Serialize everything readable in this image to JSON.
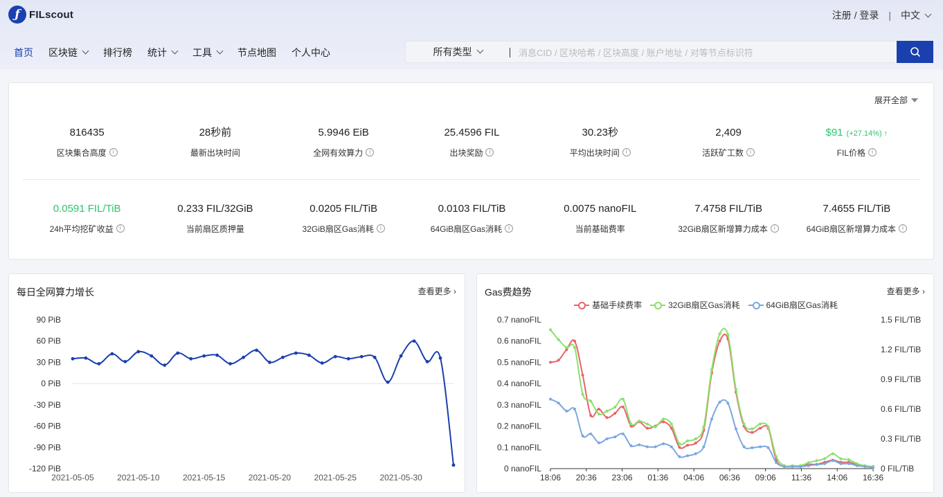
{
  "header": {
    "logo_text": "FILscout",
    "auth": "注册 / 登录",
    "separator": "|",
    "language": "中文"
  },
  "nav": {
    "items": [
      {
        "label": "首页",
        "active": true,
        "dropdown": false
      },
      {
        "label": "区块链",
        "active": false,
        "dropdown": true
      },
      {
        "label": "排行榜",
        "active": false,
        "dropdown": false
      },
      {
        "label": "统计",
        "active": false,
        "dropdown": true
      },
      {
        "label": "工具",
        "active": false,
        "dropdown": true
      },
      {
        "label": "节点地图",
        "active": false,
        "dropdown": false
      },
      {
        "label": "个人中心",
        "active": false,
        "dropdown": false
      }
    ]
  },
  "search": {
    "type_label": "所有类型",
    "placeholder": "消息CID / 区块哈希 / 区块高度 / 账户地址 / 对等节点标识符"
  },
  "stats": {
    "expand_label": "展开全部",
    "row1": [
      {
        "value": "816435",
        "label": "区块集合高度",
        "info": true
      },
      {
        "value": "28秒前",
        "label": "最新出块时间",
        "info": false
      },
      {
        "value": "5.9946 EiB",
        "label": "全网有效算力",
        "info": true
      },
      {
        "value": "25.4596 FIL",
        "label": "出块奖励",
        "info": true
      },
      {
        "value": "30.23秒",
        "label": "平均出块时间",
        "info": true
      },
      {
        "value": "2,409",
        "label": "活跃矿工数",
        "info": true
      },
      {
        "value": "$91",
        "change": "(+27.14%) ↑",
        "label": "FIL价格",
        "info": true,
        "green": true
      }
    ],
    "row2": [
      {
        "value": "0.0591 FIL/TiB",
        "label": "24h平均挖矿收益",
        "info": true,
        "green": true
      },
      {
        "value": "0.233 FIL/32GiB",
        "label": "当前扇区质押量",
        "info": false
      },
      {
        "value": "0.0205 FIL/TiB",
        "label": "32GiB扇区Gas消耗",
        "info": true
      },
      {
        "value": "0.0103 FIL/TiB",
        "label": "64GiB扇区Gas消耗",
        "info": true
      },
      {
        "value": "0.0075 nanoFIL",
        "label": "当前基础费率",
        "info": false
      },
      {
        "value": "7.4758 FIL/TiB",
        "label": "32GiB扇区新增算力成本",
        "info": true
      },
      {
        "value": "7.4655 FIL/TiB",
        "label": "64GiB扇区新增算力成本",
        "info": true
      }
    ]
  },
  "power_chart": {
    "title": "每日全网算力增长",
    "more_label": "查看更多 ›"
  },
  "gas_chart": {
    "title": "Gas费趋势",
    "more_label": "查看更多 ›"
  },
  "chart_data": [
    {
      "type": "line",
      "title": "每日全网算力增长",
      "xlabel": "",
      "ylabel": "",
      "y_unit": "PiB",
      "ylim": [
        -120,
        90
      ],
      "yticks": [
        90,
        60,
        30,
        0,
        -30,
        -60,
        -90,
        -120
      ],
      "yticklabels": [
        "90 PiB",
        "60 PiB",
        "30 PiB",
        "0 PiB",
        "-30 PiB",
        "-60 PiB",
        "-90 PiB",
        "-120 PiB"
      ],
      "xticklabels": [
        "2021-05-05",
        "2021-05-10",
        "2021-05-15",
        "2021-05-20",
        "2021-05-25",
        "2021-05-30"
      ],
      "grid": false,
      "color": "#1a3fae",
      "x": [
        "2021-05-05",
        "2021-05-06",
        "2021-05-07",
        "2021-05-08",
        "2021-05-09",
        "2021-05-10",
        "2021-05-11",
        "2021-05-12",
        "2021-05-13",
        "2021-05-14",
        "2021-05-15",
        "2021-05-16",
        "2021-05-17",
        "2021-05-18",
        "2021-05-19",
        "2021-05-20",
        "2021-05-21",
        "2021-05-22",
        "2021-05-23",
        "2021-05-24",
        "2021-05-25",
        "2021-05-26",
        "2021-05-27",
        "2021-05-28",
        "2021-05-29",
        "2021-05-30",
        "2021-05-31",
        "2021-06-01",
        "2021-06-02",
        "2021-06-03"
      ],
      "values": [
        35,
        36,
        28,
        42,
        31,
        45,
        39,
        26,
        43,
        35,
        39,
        40,
        28,
        37,
        47,
        30,
        37,
        43,
        40,
        29,
        38,
        35,
        38,
        37,
        2,
        39,
        60,
        31,
        36,
        -115
      ]
    },
    {
      "type": "line",
      "title": "Gas费趋势",
      "xticklabels": [
        "18:06",
        "20:36",
        "23:06",
        "01:36",
        "04:06",
        "06:36",
        "09:06",
        "11:36",
        "14:06",
        "16:36"
      ],
      "y_left": {
        "ylim": [
          0,
          0.7
        ],
        "unit": "nanoFIL",
        "ticklabels": [
          "0.7 nanoFIL",
          "0.6 nanoFIL",
          "0.5 nanoFIL",
          "0.4 nanoFIL",
          "0.3 nanoFIL",
          "0.2 nanoFIL",
          "0.1 nanoFIL",
          "0 nanoFIL"
        ]
      },
      "y_right": {
        "ylim": [
          0,
          1.5
        ],
        "unit": "FIL/TiB",
        "ticklabels": [
          "1.5 FIL/TiB",
          "1.2 FIL/TiB",
          "0.9 FIL/TiB",
          "0.6 FIL/TiB",
          "0.3 FIL/TiB",
          "0 FIL/TiB"
        ]
      },
      "legend": "top-center",
      "series": [
        {
          "name": "基础手续费率",
          "axis": "left",
          "color": "#e8626b",
          "values": [
            0.5,
            0.51,
            0.56,
            0.6,
            0.44,
            0.25,
            0.28,
            0.24,
            0.26,
            0.29,
            0.2,
            0.22,
            0.19,
            0.2,
            0.22,
            0.19,
            0.1,
            0.11,
            0.12,
            0.18,
            0.45,
            0.6,
            0.61,
            0.36,
            0.2,
            0.17,
            0.19,
            0.19,
            0.04,
            0.01,
            0.01,
            0.01,
            0.02,
            0.02,
            0.03,
            0.04,
            0.03,
            0.03,
            0.02,
            0.01,
            0.01
          ]
        },
        {
          "name": "32GiB扇区Gas消耗",
          "axis": "right",
          "color": "#8be06b",
          "values": [
            1.4,
            1.3,
            1.22,
            1.22,
            0.75,
            0.68,
            0.55,
            0.58,
            0.62,
            0.7,
            0.45,
            0.48,
            0.45,
            0.42,
            0.5,
            0.45,
            0.25,
            0.28,
            0.3,
            0.42,
            1.0,
            1.36,
            1.35,
            0.8,
            0.45,
            0.4,
            0.45,
            0.42,
            0.12,
            0.03,
            0.03,
            0.03,
            0.06,
            0.08,
            0.1,
            0.15,
            0.1,
            0.09,
            0.05,
            0.03,
            0.02
          ]
        },
        {
          "name": "64GiB扇区Gas消耗",
          "axis": "right",
          "color": "#7aa7e0",
          "values": [
            0.7,
            0.66,
            0.58,
            0.6,
            0.33,
            0.35,
            0.26,
            0.3,
            0.32,
            0.35,
            0.23,
            0.24,
            0.22,
            0.22,
            0.25,
            0.22,
            0.12,
            0.13,
            0.15,
            0.22,
            0.5,
            0.67,
            0.66,
            0.4,
            0.22,
            0.21,
            0.22,
            0.21,
            0.06,
            0.02,
            0.02,
            0.02,
            0.03,
            0.04,
            0.05,
            0.08,
            0.05,
            0.05,
            0.03,
            0.02,
            0.01
          ]
        }
      ]
    }
  ]
}
